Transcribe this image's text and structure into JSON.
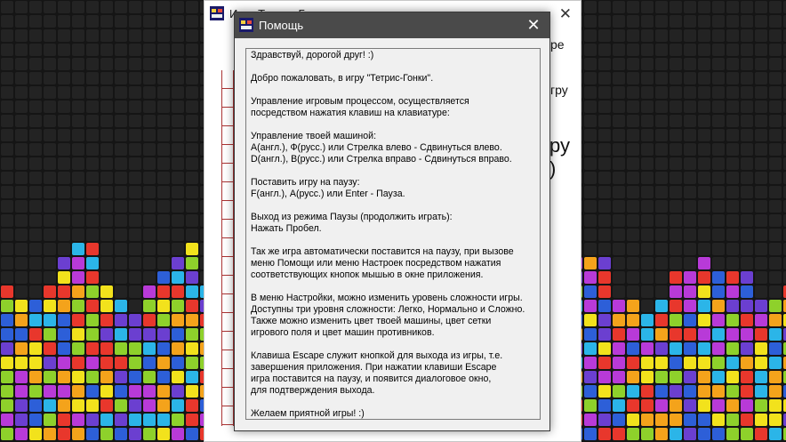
{
  "background": {
    "block_colors": [
      "#e8372c",
      "#f4a31b",
      "#f2e21c",
      "#8ed12b",
      "#2bb5e8",
      "#2d5fd8",
      "#b83ad8",
      "#6b3fd0"
    ]
  },
  "main_window": {
    "title": "Игра Тетрис-Гонки",
    "close_glyph": "✕",
    "side_fragments": [
      "ре",
      "гру",
      "ру",
      ")"
    ]
  },
  "help_dialog": {
    "title": "Помощь",
    "close_glyph": "✕",
    "lines": [
      "Здравствуй, дорогой друг! :)",
      "",
      "Добро пожаловать, в игру \"Тетрис-Гонки\".",
      "",
      "Управление игровым процессом, осуществляется",
      "посредством нажатия клавиш на клавиатуре:",
      "",
      "Управление твоей машиной:",
      "A(англ.), Ф(русс.) или Стрелка влево - Сдвинуться влево.",
      "D(англ.), В(русс.) или Стрелка вправо - Сдвинуться вправо.",
      "",
      "Поставить игру на паузу:",
      "F(англ.), А(русс.) или Enter - Пауза.",
      "",
      "Выход из режима Паузы (продолжить играть):",
      "Нажать Пробел.",
      "",
      "Так же игра автоматически поставится на паузу, при вызове",
      "меню Помощи или меню Настроек посредством нажатия",
      "соответствующих кнопок мышью в окне приложения.",
      "",
      "В меню Настройки, можно изменить уровень сложности игры.",
      "Доступны три уровня сложности: Легко, Нормально и Сложно.",
      "Также можно изменить цвет твоей машины, цвет сетки",
      "игрового поля и цвет машин противников.",
      "",
      "Клавиша Escape служит кнопкой для выхода из игры, т.е.",
      "завершения приложения. При нажатии клавиши Escape",
      "игра поставится на паузу, и появится диалоговое окно,",
      "для подтверждения выхода.",
      "",
      "Желаем приятной игры! :)"
    ]
  }
}
